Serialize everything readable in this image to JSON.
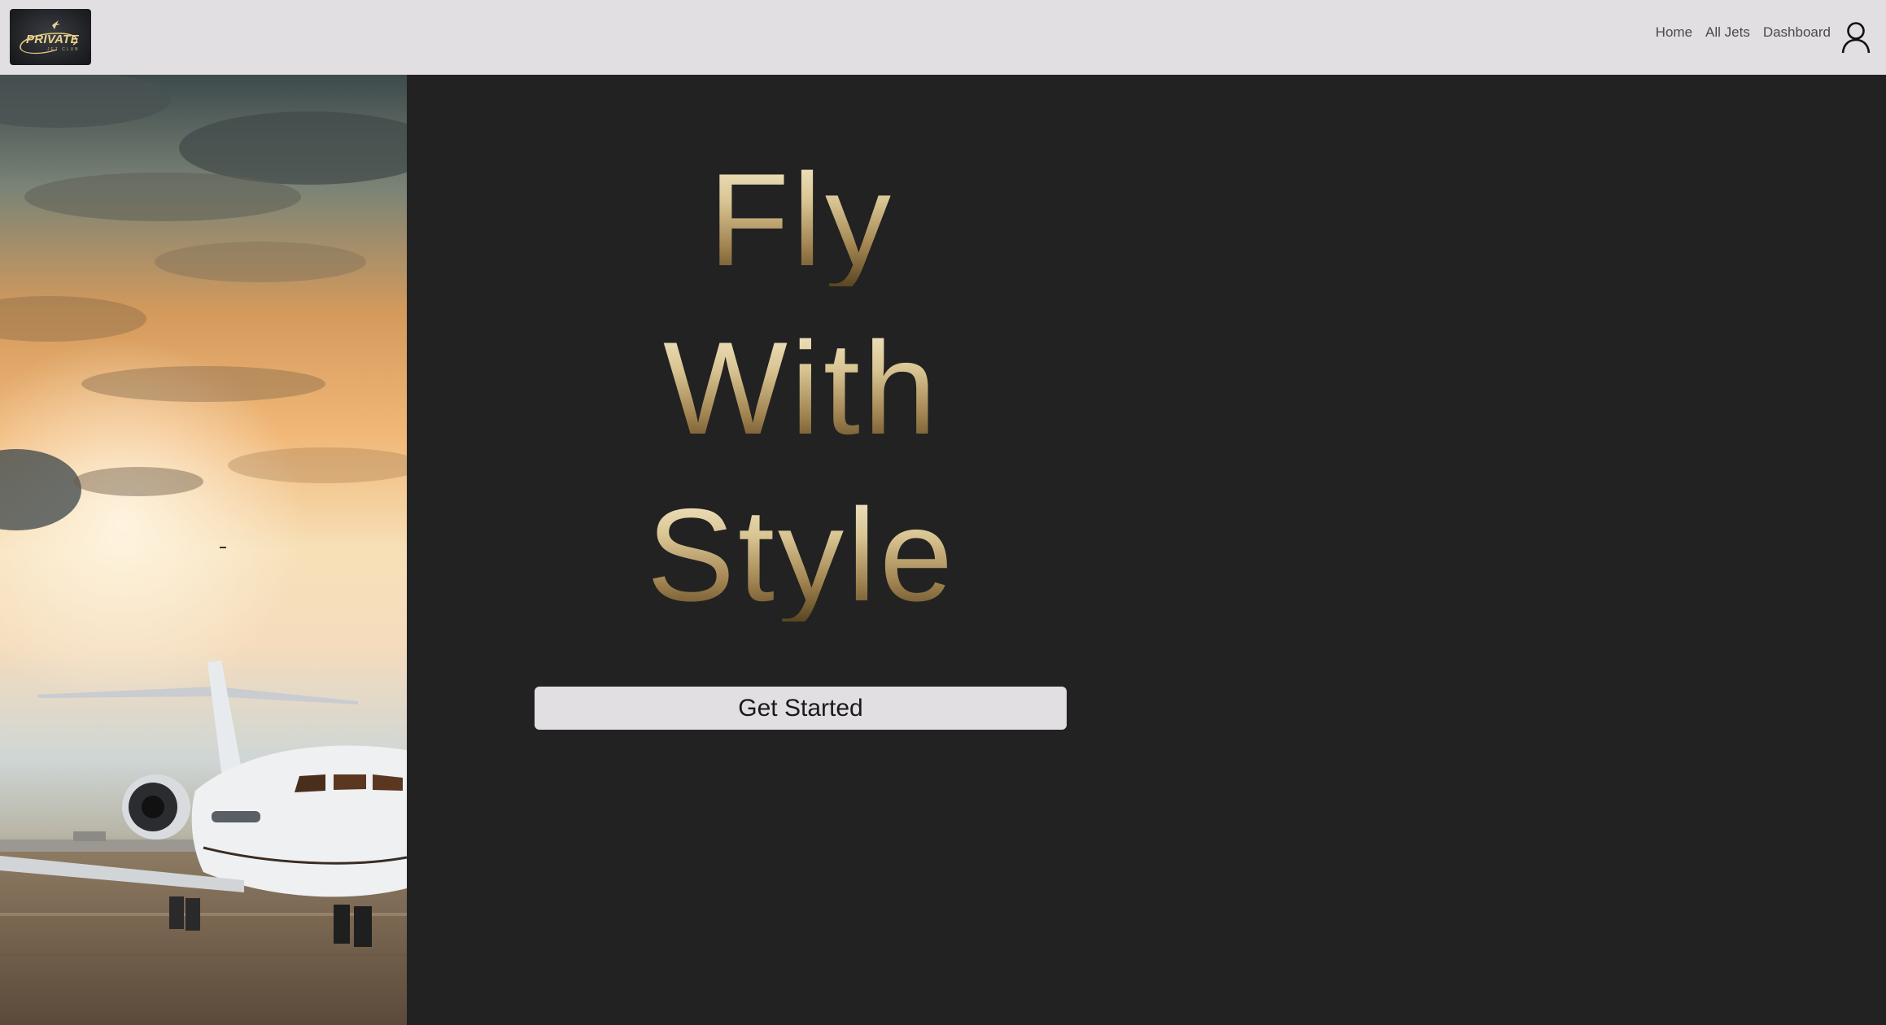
{
  "header": {
    "logo": {
      "name": "private-jet-club-logo",
      "text": "PRIVATE",
      "subtext": "JET CLUB"
    },
    "nav": [
      {
        "label": "Home"
      },
      {
        "label": "All Jets"
      },
      {
        "label": "Dashboard"
      }
    ],
    "user_icon": "user-account-icon"
  },
  "hero": {
    "image": "private-jet-sunset-photo",
    "headline_lines": [
      "Fly",
      "With",
      "Style"
    ],
    "cta_label": "Get Started"
  },
  "colors": {
    "navbar_bg": "#e1dfe1",
    "page_bg": "#222222",
    "headline_gold_light": "#f4e9c9",
    "headline_gold_dark": "#5a4522",
    "button_bg": "#e1dfe1"
  }
}
